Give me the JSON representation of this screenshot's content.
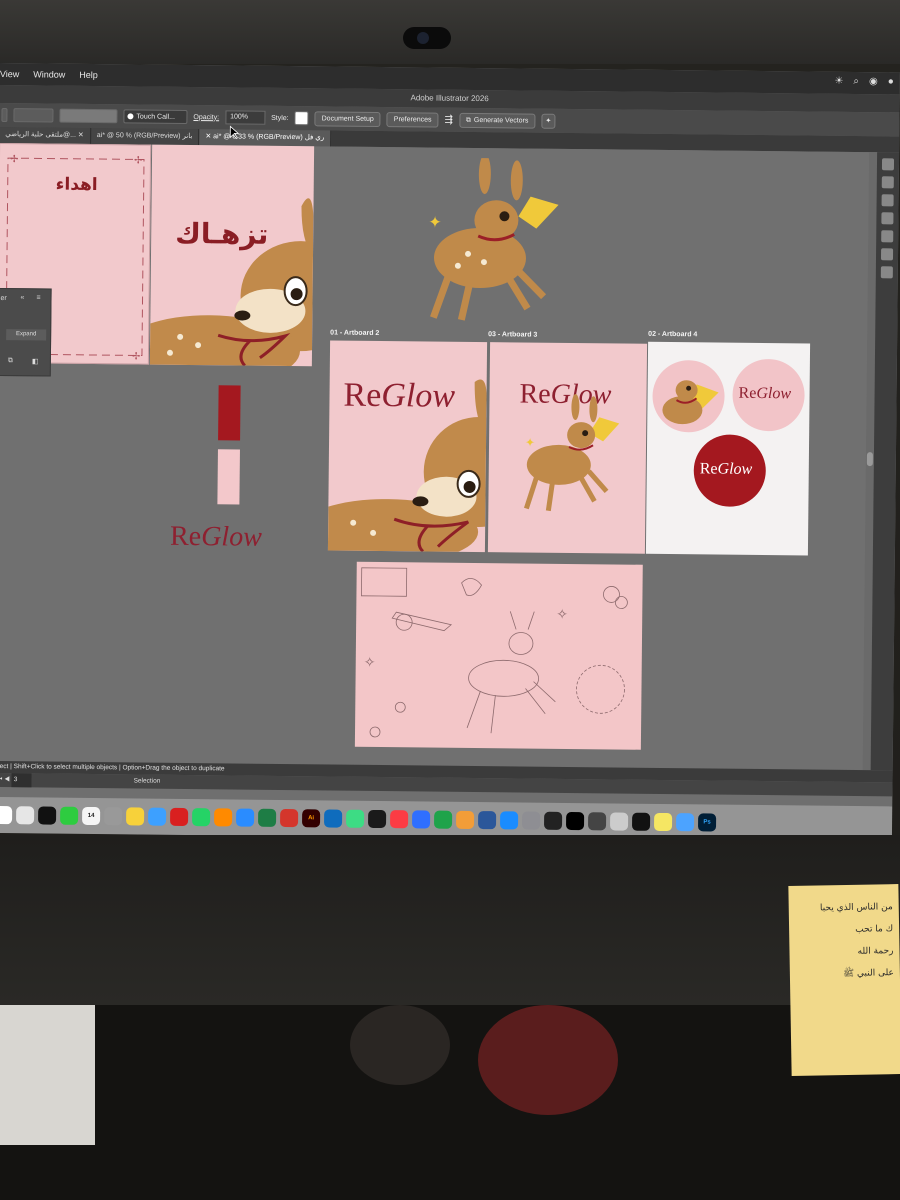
{
  "menubar": {
    "items": [
      "View",
      "Window",
      "Help"
    ]
  },
  "app_title": "Adobe Illustrator 2026",
  "control_bar": {
    "brush_label": "Touch Call...",
    "opacity_label": "Opacity:",
    "opacity_value": "100%",
    "style_label": "Style:",
    "document_setup": "Document Setup",
    "preferences": "Preferences",
    "generate_vectors": "Generate Vectors"
  },
  "tabs": [
    {
      "label": "ملتقى حلبة الرياضي@...",
      "active": false
    },
    {
      "label": "ai* @ 50 % (RGB/Preview) بانر",
      "active": false
    },
    {
      "label": "ai* @ 8.33 % (RGB/Preview) ري فل",
      "active": true
    }
  ],
  "canvas": {
    "artboard_top_left_text": "اهداء",
    "artboard_top_mid_text": "تزهـاك",
    "panel_expand": "Expand",
    "panel_label": "er",
    "artboard_labels": [
      "01 - Artboard 2",
      "03 - Artboard 3",
      "02 - Artboard 4"
    ],
    "brand_re": "Re",
    "brand_glow": "Glow",
    "swatch_colors": [
      "#a4181f",
      "#f3c8cb"
    ]
  },
  "status_bar": "elect  |  Shift+Click to select multiple objects  |  Option+Drag the object to duplicate",
  "bottom_bar": {
    "page": "3",
    "tool": "Selection"
  },
  "dock": {
    "apps": [
      "Chrome",
      "Cricut",
      "CapCut",
      "FaceTime",
      "Calendar",
      "Contacts",
      "Notes",
      "Freeform",
      "Opera",
      "WhatsApp",
      "Setapp",
      "Safari",
      "Excel",
      "Acrobat",
      "Illustrator",
      "Outlook",
      "Android",
      "Claquette",
      "Music",
      "Keynote",
      "Numbers",
      "Pages",
      "Word",
      "App Store",
      "System Settings",
      "Figma",
      "TikTok",
      "Tab",
      "Screenshot",
      "Mango",
      "Stickies",
      "Finder",
      "Photoshop"
    ],
    "calendar_day": "14"
  },
  "sticky_note": [
    "من الناس الذي يحبا",
    "ك ما تحب",
    "رحمة الله",
    "على النبي ﷺ"
  ],
  "colors": {
    "accent": "#8e2030",
    "pink": "#f2c9cc",
    "canvas": "#707070"
  }
}
